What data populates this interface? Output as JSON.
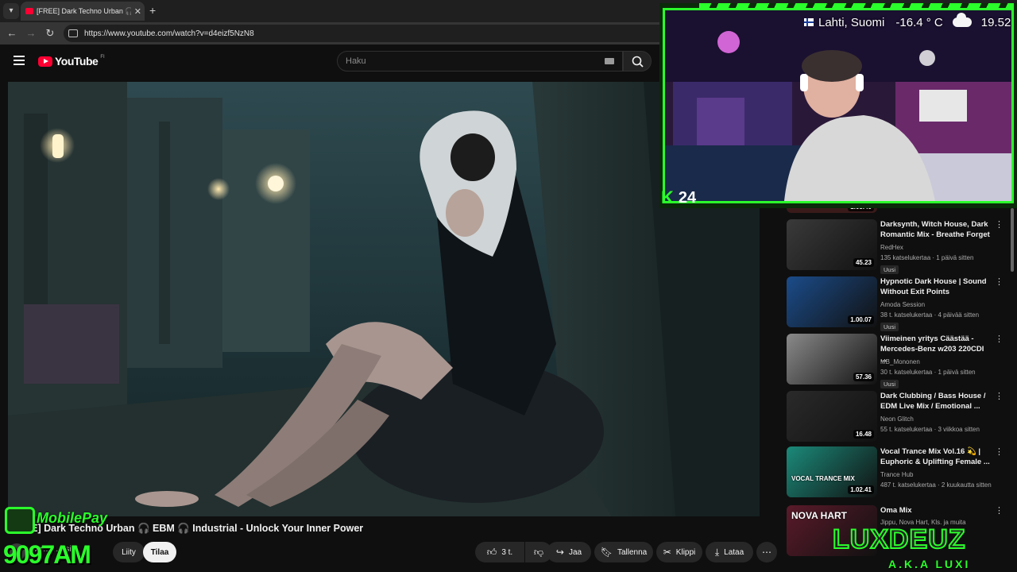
{
  "browser": {
    "tab_title": "[FREE] Dark Techno Urban 🎧 🔊",
    "url": "https://www.youtube.com/watch?v=d4eizf5NzN8"
  },
  "yt": {
    "logo_text": "YouTube",
    "region": "FI",
    "search_placeholder": "Haku"
  },
  "video": {
    "title": "[FREE] Dark Techno Urban 🎧 EBM 🎧 Industrial - Unlock Your Inner Power",
    "channel_partial": "Ar… …esi…",
    "join_label": "Liity",
    "subscribe_label": "Tilaa",
    "like_label": "3 t.",
    "share_label": "Jaa",
    "save_label": "Tallenna",
    "clip_label": "Klippi",
    "download_label": "Lataa"
  },
  "recommendations": [
    {
      "title": "Darksynth, Witch House, Dark Romantic Mix - Breathe Forget",
      "channel": "RedHex",
      "meta": "135 katselukertaa · 1 päivä sitten",
      "badge": "Uusi",
      "duration": "45.23",
      "thumb_color": "#3a3a3a"
    },
    {
      "title": "Hypnotic Dark House | Sound Without Exit Points",
      "channel": "Amoda Session",
      "meta": "38 t. katselukertaa · 4 päivää sitten",
      "badge": "Uusi",
      "duration": "1.00.07",
      "thumb_color": "#1b4c8a"
    },
    {
      "title": "Viimeinen yritys Cäästää - Mercedes-Benz w203 220CDI ...",
      "channel": "MB_Mononen",
      "meta": "30 t. katselukertaa · 1 päivä sitten",
      "badge": "Uusi",
      "duration": "57.36",
      "thumb_color": "#8a8a8a"
    },
    {
      "title": "Dark Clubbing / Bass House / EDM Live Mix / Emotional ...",
      "channel": "Neon Glitch",
      "meta": "55 t. katselukertaa · 3 viikkoa sitten",
      "badge": "",
      "duration": "16.48",
      "thumb_color": "#2a2a2a"
    },
    {
      "title": "Vocal Trance Mix Vol.16 💫 | Euphoric & Uplifting Female ...",
      "channel": "Trance Hub",
      "meta": "487 t. katselukertaa · 2 kuukautta sitten",
      "badge": "",
      "duration": "1.02.41",
      "thumb_color": "#1b8a7a",
      "thumb_text": "VOCAL TRANCE MIX"
    },
    {
      "title": "Oma Mix",
      "channel": "Jippu, Nova Hart, Kls. ja muita",
      "meta": "",
      "badge": "",
      "duration": "",
      "thumb_color": "#5a1a2a",
      "thumb_text": "NOVA HART"
    }
  ],
  "first_rec_partial_duration": "1.05.40",
  "stream": {
    "weather_location": "Lahti, Suomi",
    "weather_temp": "-16.4 ° C",
    "time": "19.52",
    "kick_letter": "K",
    "viewer_count": "24",
    "mobilepay_label": "MobilePay",
    "phone_number": "9097AM",
    "brand_name": "LUXDEUZ",
    "brand_sub": "A.K.A LUXI",
    "accent_color": "#2bff2b"
  },
  "icons": [
    "dropdown-icon",
    "youtube-favicon",
    "speaker-icon",
    "close-icon",
    "plus-icon",
    "back-icon",
    "forward-icon",
    "reload-icon",
    "site-info-icon",
    "menu-icon",
    "keyboard-icon",
    "search-icon",
    "like-icon",
    "dislike-icon",
    "share-icon",
    "save-icon",
    "scissors-icon",
    "download-icon",
    "more-icon",
    "cloud-icon"
  ]
}
